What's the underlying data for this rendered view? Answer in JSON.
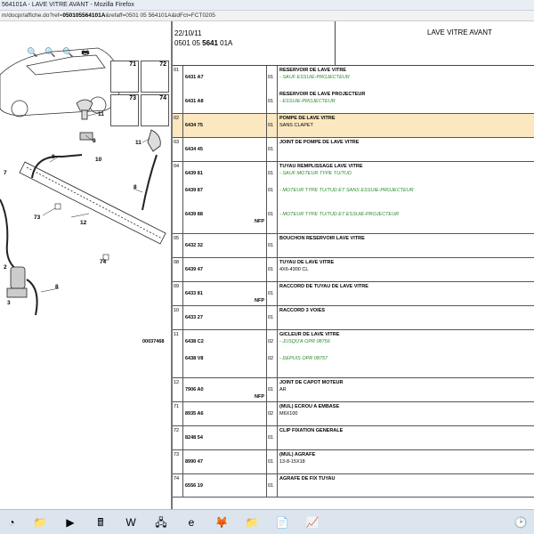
{
  "window": {
    "title": "564101A - LAVE VITRE AVANT - Mozilla Firefox",
    "url_prefix": "m/docpr/affiche.do?ref=",
    "url_ref": "050105564101A",
    "url_rest": "&refaff=0501 05 564101A&idFct=FCT0205"
  },
  "diagram": {
    "zoom_in_icon": "zoom-in-icon",
    "zoom_out_icon": "zoom-out-icon",
    "fit_icon": "zoom-fit-icon",
    "print_icon": "print-icon",
    "thumbs": [
      "71",
      "72",
      "73",
      "74"
    ],
    "callouts": [
      "11",
      "8",
      "10",
      "9",
      "11",
      "8",
      "7",
      "73",
      "12",
      "74",
      "2",
      "8",
      "3"
    ],
    "reference_code": "00037468"
  },
  "header": {
    "date": "22/10/11",
    "ref_prefix": "0501 05 ",
    "ref_bold": "5641",
    "ref_suffix": " 01A",
    "title": "LAVE VITRE AVANT"
  },
  "rows": [
    {
      "item": "01",
      "lines": [
        {
          "pn": "6431 A7",
          "qty": "01",
          "desc": "RESERVOIR DE LAVE VITRE",
          "sub": "- SAUF ESSUIE-PROJECTEUR",
          "green": true
        },
        {
          "pn": "6431 A8",
          "qty": "01",
          "desc": "RESERVOIR DE LAVE PROJECTEUR",
          "sub": "- ESSUIE-PROJECTEUR",
          "green": true
        }
      ]
    },
    {
      "item": "02",
      "highlight": true,
      "lines": [
        {
          "pn": "6434 75",
          "qty": "01",
          "desc": "POMPE DE LAVE VITRE",
          "sub": "SANS CLAPET",
          "green": false
        }
      ]
    },
    {
      "item": "03",
      "lines": [
        {
          "pn": "6434 45",
          "qty": "01",
          "desc": "JOINT DE POMPE DE LAVE VITRE",
          "sub": "",
          "green": false
        }
      ]
    },
    {
      "item": "04",
      "lines": [
        {
          "pn": "6439 81",
          "qty": "01",
          "desc": "TUYAU REMPLISSAGE LAVE VITRE",
          "sub": "- SAUF MOTEUR TYPE TU/TUD",
          "green": true
        },
        {
          "pn": "6439 87",
          "qty": "01",
          "desc": "",
          "sub": "- MOTEUR TYPE TU/TUD ET SANS ESSUIE-PROJECTEUR",
          "green": true
        },
        {
          "pn": "6439 88",
          "qty": "01",
          "desc": "",
          "sub": "- MOTEUR TYPE TU/TUD ET ESSUIE-PROJECTEUR",
          "green": true,
          "nfp": "NFP"
        }
      ]
    },
    {
      "item": "05",
      "lines": [
        {
          "pn": "6432 32",
          "qty": "01",
          "desc": "BOUCHON RESERVOIR LAVE VITRE",
          "sub": "",
          "green": false
        }
      ]
    },
    {
      "item": "08",
      "lines": [
        {
          "pn": "6439 47",
          "qty": "01",
          "desc": "TUYAU DE LAVE VITRE",
          "sub": "4X6-4300 CL",
          "green": false
        }
      ]
    },
    {
      "item": "09",
      "lines": [
        {
          "pn": "6433 81",
          "qty": "01",
          "desc": "RACCORD DE TUYAU DE LAVE VITRE",
          "sub": "",
          "green": false,
          "nfp": "NFP"
        }
      ]
    },
    {
      "item": "10",
      "lines": [
        {
          "pn": "6433 27",
          "qty": "01",
          "desc": "RACCORD 3 VOIES",
          "sub": "",
          "green": false
        }
      ]
    },
    {
      "item": "11",
      "lines": [
        {
          "pn": "6438 C2",
          "qty": "02",
          "desc": "GICLEUR DE LAVE VITRE",
          "sub": "- JUSQU'A OPR 08756",
          "green": true
        },
        {
          "pn": "6438 V8",
          "qty": "02",
          "desc": "",
          "sub": "- DEPUIS OPR 08757",
          "green": true
        }
      ]
    },
    {
      "item": "12",
      "lines": [
        {
          "pn": "7906 A0",
          "qty": "01",
          "desc": "JOINT DE CAPOT MOTEUR",
          "sub": "AR",
          "green": false,
          "nfp": "NFP"
        }
      ]
    },
    {
      "item": "71",
      "lines": [
        {
          "pn": "8935 A6",
          "qty": "02",
          "desc": "(MUL) ECROU A EMBASE",
          "sub": "M6X100",
          "green": false
        }
      ]
    },
    {
      "item": "72",
      "lines": [
        {
          "pn": "8248 54",
          "qty": "01",
          "desc": "CLIP FIXATION GENERALE",
          "sub": "",
          "green": false
        }
      ]
    },
    {
      "item": "73",
      "lines": [
        {
          "pn": "8990 47",
          "qty": "01",
          "desc": "(MUL) AGRAFE",
          "sub": "13-8-15X18",
          "green": false
        }
      ]
    },
    {
      "item": "74",
      "lines": [
        {
          "pn": "6556 19",
          "qty": "01",
          "desc": "AGRAFE DE FIX TUYAU",
          "sub": "",
          "green": false
        }
      ]
    }
  ],
  "taskbar": {
    "start_icon": "windows-start-icon",
    "clock_icon": "clock-icon",
    "items": [
      "folder-icon",
      "media-player-icon",
      "calculator-icon",
      "word-icon",
      "network-icon",
      "internet-explorer-icon",
      "firefox-icon",
      "folder-icon",
      "document-icon",
      "chart-icon"
    ]
  }
}
